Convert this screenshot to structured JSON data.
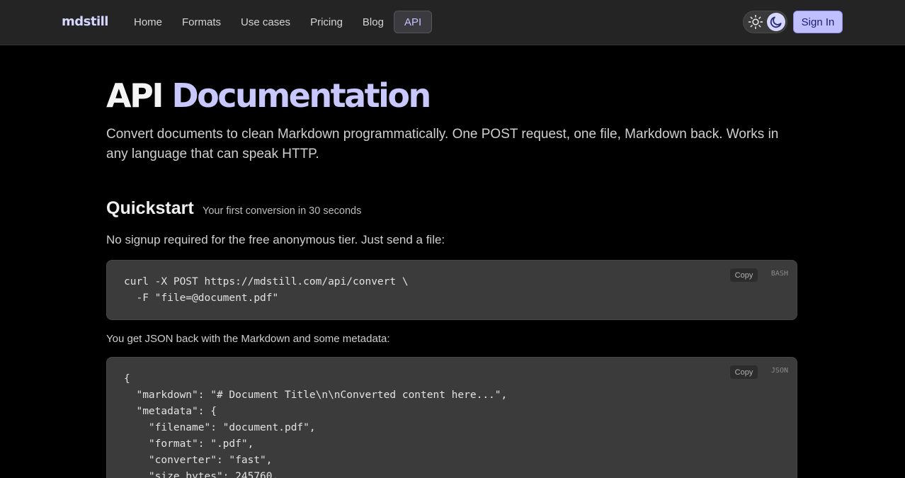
{
  "brand": {
    "logo": "mdstill"
  },
  "nav": {
    "links": [
      "Home",
      "Formats",
      "Use cases",
      "Pricing",
      "Blog",
      "API"
    ],
    "active": "API",
    "signin": "Sign In"
  },
  "hero": {
    "title_plain": "API",
    "title_accent": "Documentation",
    "intro": "Convert documents to clean Markdown programmatically. One POST request, one file, Markdown back. Works in any language that can speak HTTP."
  },
  "quickstart": {
    "title": "Quickstart",
    "subtitle": "Your first conversion in 30 seconds",
    "note": "No signup required for the free anonymous tier. Just send a file:",
    "bash_code": "curl -X POST https://mdstill.com/api/convert \\\n  -F \"file=@document.pdf\"",
    "bash_lang": "BASH",
    "copy_label": "Copy",
    "json_intro": "You get JSON back with the Markdown and some metadata:",
    "json_code": "{\n  \"markdown\": \"# Document Title\\n\\nConverted content here...\",\n  \"metadata\": {\n    \"filename\": \"document.pdf\",\n    \"format\": \".pdf\",\n    \"converter\": \"fast\",\n    \"size_bytes\": 245760,",
    "json_lang": "JSON"
  },
  "colors": {
    "accent": "#c8c8ff",
    "background": "#000000",
    "nav_bg": "#242424",
    "code_bg": "#3b3b3c"
  },
  "icons": {
    "theme_light": "sun-icon",
    "theme_dark": "moon-icon"
  }
}
